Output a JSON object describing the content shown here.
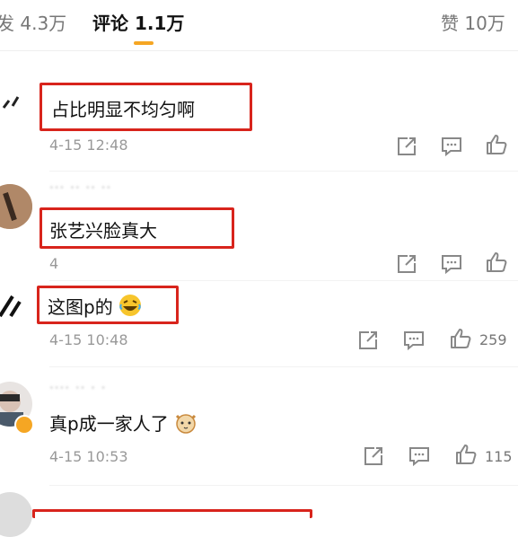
{
  "tabs": {
    "repost": "发 4.3万",
    "comments": "评论 1.1万",
    "likes": "赞 10万"
  },
  "comments": [
    {
      "text": "占比明显不均匀啊",
      "time": "4-15 12:48",
      "likes": ""
    },
    {
      "username": "··· ·· ·· ··",
      "text": "张艺兴脸真大",
      "time": "4",
      "likes": ""
    },
    {
      "text": "这图p的",
      "time": "4-15 10:48",
      "likes": "259"
    },
    {
      "username": "···· ·· · ·",
      "text": "真p成一家人了",
      "time": "4-15 10:53",
      "likes": "115"
    }
  ],
  "icons": {
    "share": "share-icon",
    "comment": "comment-icon",
    "like": "thumbs-up-icon"
  },
  "colors": {
    "accent": "#f5a623",
    "highlight_box": "#d8241c",
    "muted": "#999999"
  }
}
